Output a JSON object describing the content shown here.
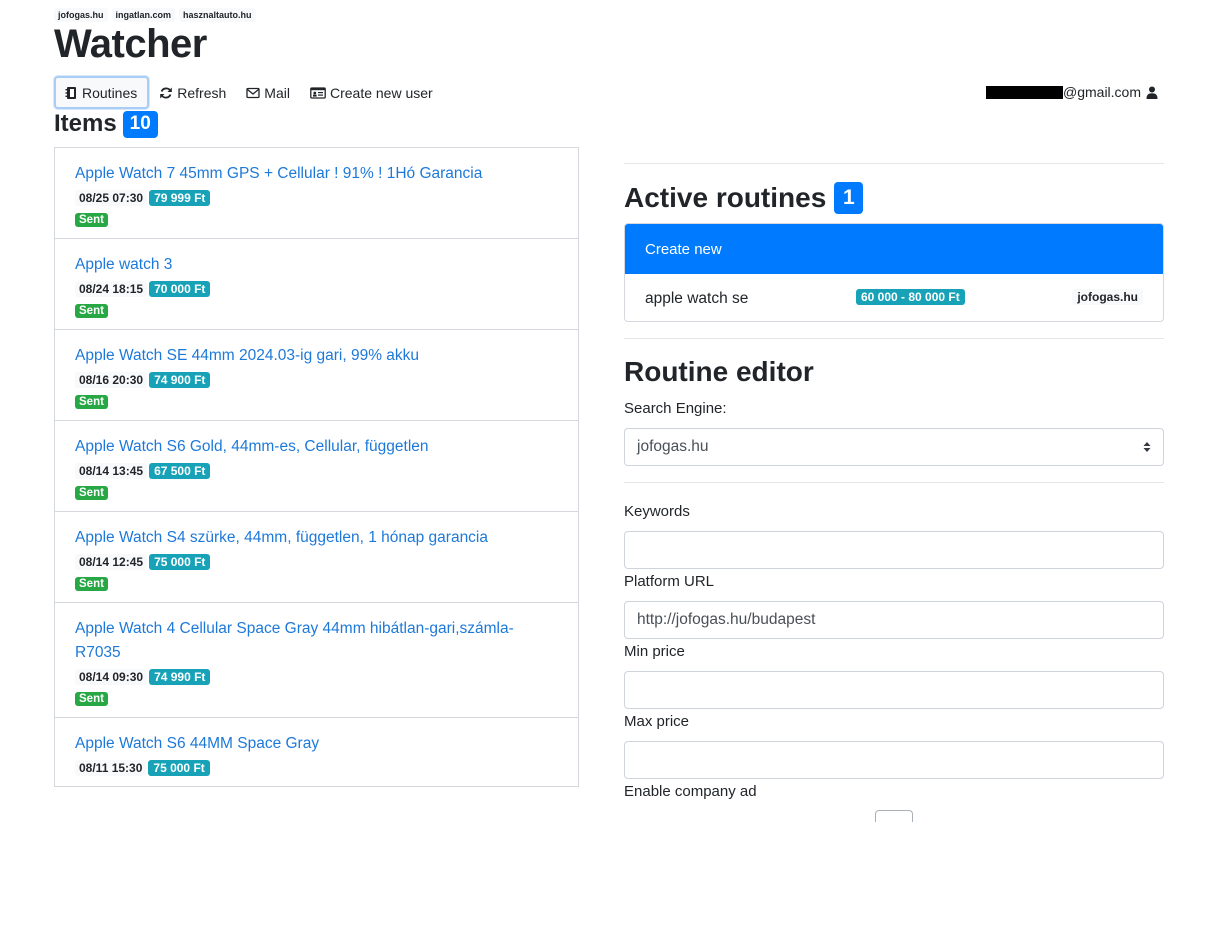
{
  "sites": [
    "jofogas.hu",
    "ingatlan.com",
    "hasznaltauto.hu"
  ],
  "app_title": "Watcher",
  "nav": {
    "routines": "Routines",
    "refresh": "Refresh",
    "mail": "Mail",
    "create_user": "Create new user"
  },
  "user": {
    "email_suffix": "@gmail.com"
  },
  "items": {
    "heading": "Items",
    "count": "10",
    "list": [
      {
        "title": "Apple Watch 7 45mm GPS + Cellular ! 91% ! 1Hó Garancia",
        "date": "08/25 07:30",
        "price": "79 999 Ft",
        "status": "Sent"
      },
      {
        "title": "Apple watch 3",
        "date": "08/24 18:15",
        "price": "70 000 Ft",
        "status": "Sent"
      },
      {
        "title": "Apple Watch SE 44mm 2024.03-ig gari, 99% akku",
        "date": "08/16 20:30",
        "price": "74 900 Ft",
        "status": "Sent"
      },
      {
        "title": "Apple Watch S6 Gold, 44mm-es, Cellular, független",
        "date": "08/14 13:45",
        "price": "67 500 Ft",
        "status": "Sent"
      },
      {
        "title": "Apple Watch S4 szürke, 44mm, független, 1 hónap garancia",
        "date": "08/14 12:45",
        "price": "75 000 Ft",
        "status": "Sent"
      },
      {
        "title": "Apple Watch 4 Cellular Space Gray 44mm hibátlan-gari,számla-R7035",
        "date": "08/14 09:30",
        "price": "74 990 Ft",
        "status": "Sent"
      },
      {
        "title": "Apple Watch S6 44MM Space Gray",
        "date": "08/11 15:30",
        "price": "75 000 Ft",
        "status": ""
      }
    ]
  },
  "active_routines": {
    "heading": "Active routines",
    "count": "1",
    "create_new": "Create new",
    "routines": [
      {
        "keyword": "apple watch se",
        "price_range": "60 000 - 80 000 Ft",
        "engine": "jofogas.hu"
      }
    ]
  },
  "editor": {
    "heading": "Routine editor",
    "search_engine_label": "Search Engine:",
    "search_engine_value": "jofogas.hu",
    "keywords_label": "Keywords",
    "keywords_value": "",
    "platform_url_label": "Platform URL",
    "platform_url_value": "http://jofogas.hu/budapest",
    "min_price_label": "Min price",
    "min_price_value": "",
    "max_price_label": "Max price",
    "max_price_value": "",
    "company_ad_label": "Enable company ad"
  },
  "colors": {
    "primary": "#007bff",
    "link": "#1d79d9",
    "info": "#17a2b8",
    "success": "#28a745"
  }
}
